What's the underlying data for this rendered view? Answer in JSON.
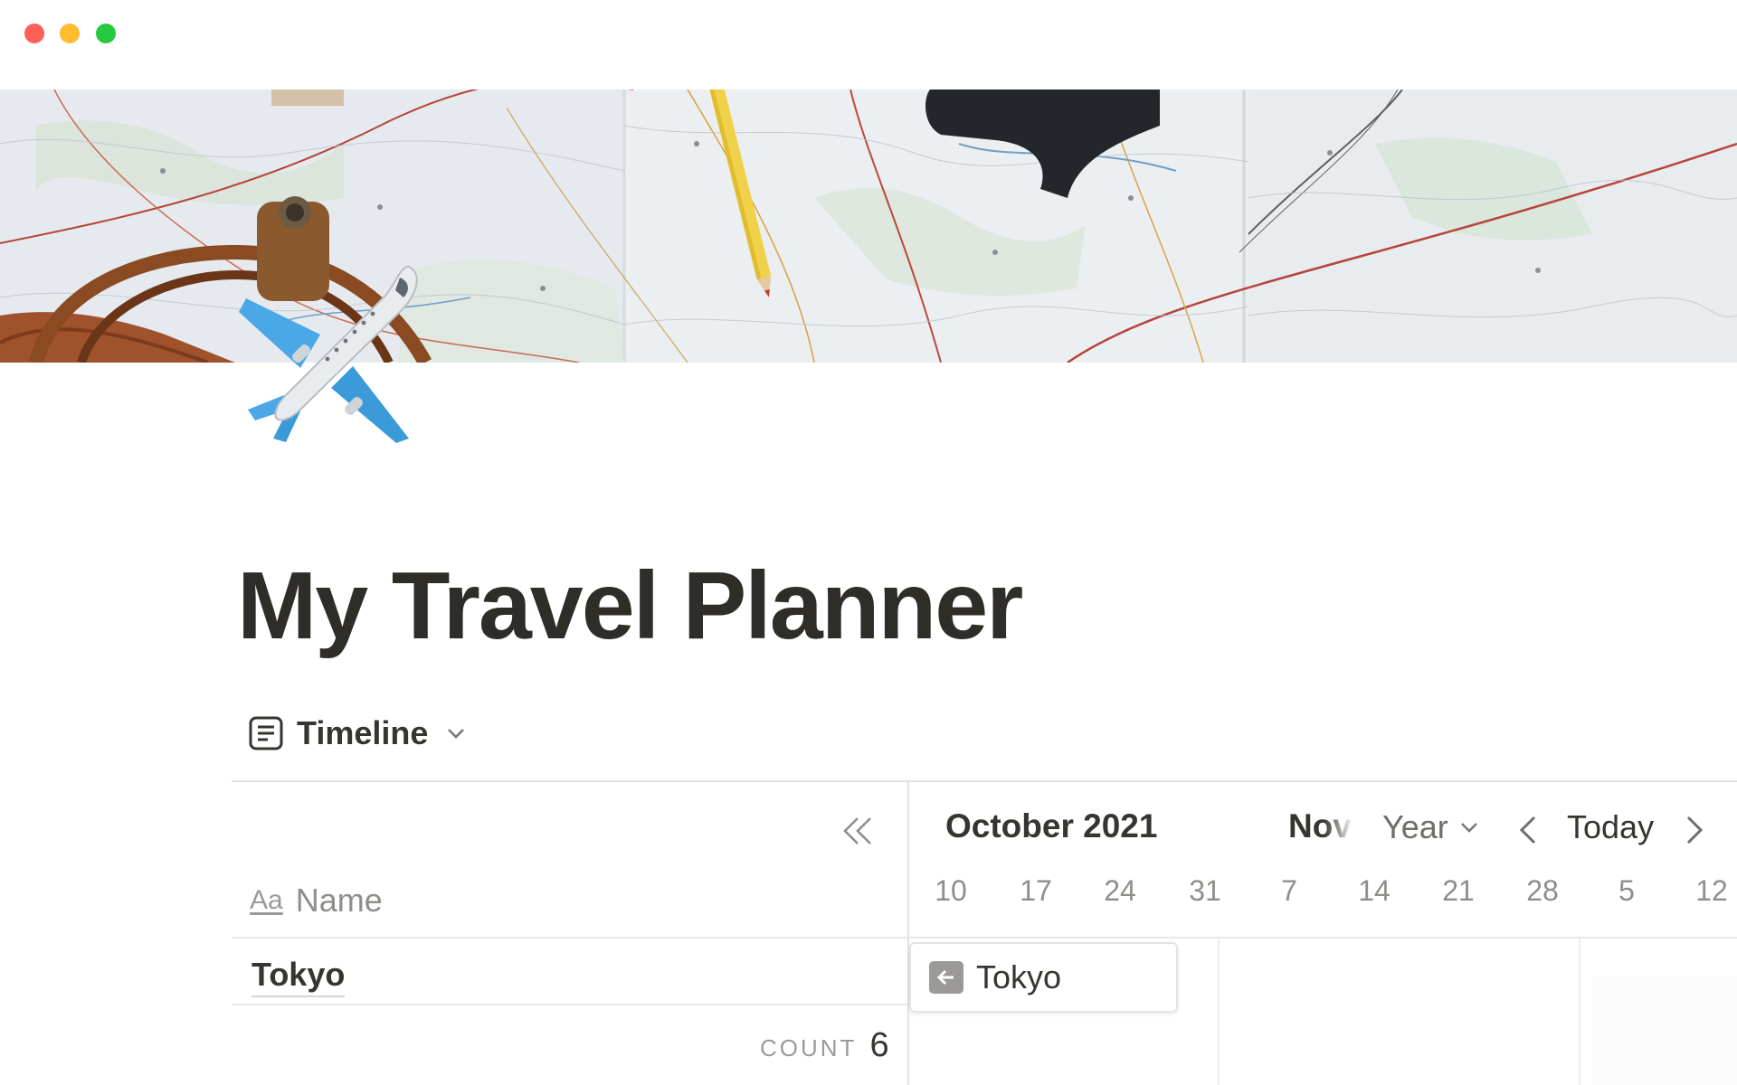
{
  "page": {
    "title": "My Travel Planner"
  },
  "view": {
    "label": "Timeline"
  },
  "table": {
    "name_icon": "Aa",
    "name_header": "Name",
    "rows": [
      "Tokyo"
    ],
    "count_label": "COUNT",
    "count_value": "6"
  },
  "timeline": {
    "current_month": "October 2021",
    "next_month": "Nov",
    "zoom": "Year",
    "today": "Today",
    "weeks": [
      "10",
      "17",
      "24",
      "31",
      "7",
      "14",
      "21",
      "28",
      "5",
      "12"
    ],
    "bars": [
      {
        "label": "Tokyo"
      }
    ]
  },
  "icons": {
    "page_icon": "airplane-icon",
    "view_icon": "document-icon",
    "collapse": "double-chevron-left-icon",
    "prev": "chevron-left-icon",
    "next": "chevron-right-icon",
    "dropdown": "chevron-down-icon",
    "bar_arrow": "arrow-left-icon"
  },
  "colors": {
    "text": "#37352f",
    "muted": "#9b9a97",
    "traffic_red": "#fe5f57",
    "traffic_yellow": "#febc2e",
    "traffic_green": "#28c840"
  }
}
